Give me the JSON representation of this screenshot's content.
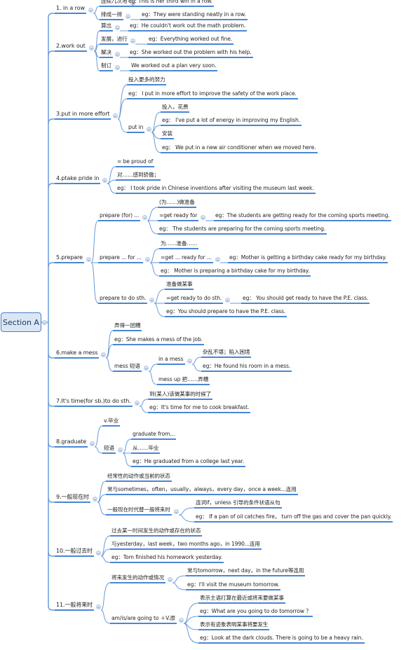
{
  "root": {
    "label": "Section A"
  },
  "colors": {
    "line": "#6a9ad8",
    "underline": "#4a86d4",
    "root_fill": "#dbe6f4",
    "root_border": "#4a7fc8"
  },
  "topics": [
    {
      "label": "1. in a row",
      "children": [
        {
          "label": "连续几次地",
          "children": [
            {
              "label": "eg: This is her third win in a row."
            }
          ]
        },
        {
          "label": "排成一排",
          "children": [
            {
              "label": "eg：They were standing neatly in a row."
            }
          ]
        }
      ]
    },
    {
      "label": "2.work out",
      "children": [
        {
          "label": "算出",
          "children": [
            {
              "label": "eg：He couldn't work out the math problem."
            }
          ]
        },
        {
          "label": "发展，进行",
          "children": [
            {
              "label": "eg：Everything worked out fine."
            }
          ]
        },
        {
          "label": "解决",
          "children": [
            {
              "label": "eg：She worked out the problem with his help."
            }
          ]
        },
        {
          "label": "制订",
          "children": [
            {
              "label": "We worked out a plan very soon."
            }
          ]
        }
      ]
    },
    {
      "label": "3.put in more effort",
      "children": [
        {
          "label": "投入更多的努力"
        },
        {
          "label": "eg： I put in more effort to improve the safety of the work place."
        },
        {
          "label": "put in",
          "children": [
            {
              "label": "投入，花费"
            },
            {
              "label": "eg： I've put a lot of energy in improving my English."
            },
            {
              "label": "安装"
            },
            {
              "label": "eg： We put in a new air conditioner when we moved here."
            }
          ]
        }
      ]
    },
    {
      "label": "4.ptake pride in",
      "children": [
        {
          "label": "= be proud of"
        },
        {
          "label": "对……感到骄傲；"
        },
        {
          "label": "eg： I took pride in Chinese inventions after visiting the museum last week."
        }
      ]
    },
    {
      "label": "5.prepare",
      "children": [
        {
          "label": "prepare (for) ...",
          "children": [
            {
              "label": "(为……)做准备"
            },
            {
              "label": "=get ready for",
              "children": [
                {
                  "label": "eg：The students are getting ready for the coming sports meeting."
                }
              ]
            },
            {
              "label": "eg： The students are preparing for the coming sports meeting."
            }
          ]
        },
        {
          "label": "prepare ... for ...",
          "children": [
            {
              "label": "为……准备……"
            },
            {
              "label": "=get ... ready for ...",
              "children": [
                {
                  "label": "eg：Mother is getting a birthday cake ready for my birthday."
                }
              ]
            },
            {
              "label": "eg： Mother is preparing a birthday cake for my  birthday."
            }
          ]
        },
        {
          "label": "prepare to do sth.",
          "children": [
            {
              "label": "准备做某事"
            },
            {
              "label": "=get ready to do sth.",
              "children": [
                {
                  "label": "eg： You should get ready to have the P.E. class."
                }
              ]
            },
            {
              "label": "eg：You should prepare to have the P.E. class."
            }
          ]
        }
      ]
    },
    {
      "label": "6.make a mess",
      "children": [
        {
          "label": "弄得一团糟"
        },
        {
          "label": "eg：She makes a mess of the job."
        },
        {
          "label": "mess 短语",
          "children": [
            {
              "label": "in a mess",
              "children": [
                {
                  "label": "杂乱不堪；陷入困境"
                },
                {
                  "label": "eg：He found his room in a mess."
                }
              ]
            },
            {
              "label": "mess up 把……弄糟"
            }
          ]
        }
      ]
    },
    {
      "label": "7.It's time(for sb.)to do sth.",
      "children": [
        {
          "label": "到(某人)该做某事的时候了"
        },
        {
          "label": "eg：It's time for me to cook breakfast."
        }
      ]
    },
    {
      "label": "8.graduate",
      "children": [
        {
          "label": "v.毕业"
        },
        {
          "label": "短语",
          "children": [
            {
              "label": "graduate from..."
            },
            {
              "label": "从……毕业"
            },
            {
              "label": "eg：He graduated from a college last year."
            }
          ]
        }
      ]
    },
    {
      "label": "9.一般现在时",
      "children": [
        {
          "label": "经常性的动作或当前的状态"
        },
        {
          "label": "常与sometimes，often，usually，always，every day，once a week...连用"
        },
        {
          "label": "一般现在时代替一般将来时",
          "children": [
            {
              "label": "连词if，unless 引导的条件状语从句"
            },
            {
              "label": "eg： If a pan of oil catches fire， turn off the gas and cover the pan quickly."
            }
          ]
        }
      ]
    },
    {
      "label": "10.一般过去时",
      "children": [
        {
          "label": "过去某一时间发生的动作或存在的状态"
        },
        {
          "label": "与yesterday，last week，two months ago，in 1990...连用"
        },
        {
          "label": "eg：Tom finished his homework yesterday."
        }
      ]
    },
    {
      "label": "11.一般将来时",
      "children": [
        {
          "label": "将来发生的动作或情况",
          "children": [
            {
              "label": "常与tomorrow，next day，in the future等连用"
            },
            {
              "label": "eg：I'll visit the museum tomorrow."
            }
          ]
        },
        {
          "label": "am/is/are going to ＋V.原",
          "children": [
            {
              "label": "表示主语打算在最近或将来要做某事"
            },
            {
              "label": "eg：What are you going to do tomorrow ？"
            },
            {
              "label": "表示有迹象表明某事将要发生"
            },
            {
              "label": "eg：Look at the dark clouds. There is going to be a heavy rain."
            }
          ]
        }
      ]
    }
  ]
}
